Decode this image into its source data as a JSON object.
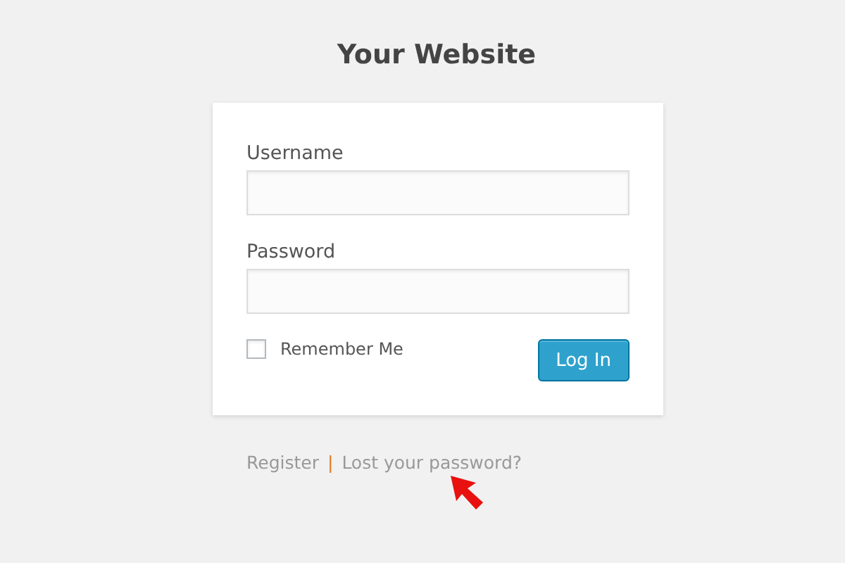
{
  "site_title": "Your Website",
  "fields": [
    {
      "label": "Username"
    },
    {
      "label": "Password"
    }
  ],
  "remember": {
    "label": "Remember Me",
    "checked": false
  },
  "submit": "Log In",
  "links": [
    {
      "kind": "link",
      "text": "Register"
    },
    {
      "kind": "separator",
      "text": "|"
    },
    {
      "kind": "link",
      "text": "Lost your password?"
    }
  ]
}
